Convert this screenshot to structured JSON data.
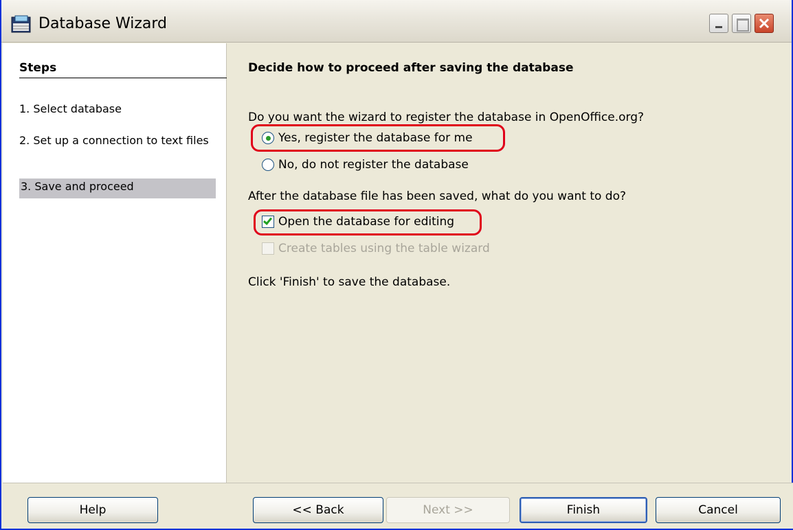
{
  "window": {
    "title": "Database Wizard"
  },
  "sidebar": {
    "heading": "Steps",
    "steps": [
      {
        "label": "1. Select database"
      },
      {
        "label": "2. Set up a connection to text files"
      },
      {
        "label": "3. Save and proceed"
      }
    ],
    "active_step": 3
  },
  "main": {
    "title": "Decide how to proceed after saving the database",
    "register_question": "Do you want the wizard to register the database in OpenOffice.org?",
    "register_yes_label": "Yes, register the database for me",
    "register_no_label": "No, do not register the database",
    "register_selected": "yes",
    "after_save_question": "After the database file has been saved, what do you want to do?",
    "open_for_editing_label": "Open the database for editing",
    "open_for_editing_checked": true,
    "create_tables_label": "Create tables using the table wizard",
    "create_tables_checked": false,
    "create_tables_enabled": false,
    "finish_note": "Click 'Finish' to save the database."
  },
  "buttons": {
    "help": "Help",
    "back": "<< Back",
    "next": "Next >>",
    "finish": "Finish",
    "cancel": "Cancel"
  },
  "colors": {
    "highlight": "#e0001a",
    "selected_step_bg": "#c4c3c8"
  },
  "icons": {
    "app": "database-icon",
    "minimize": "minimize-icon",
    "maximize": "maximize-icon",
    "close": "close-icon"
  }
}
